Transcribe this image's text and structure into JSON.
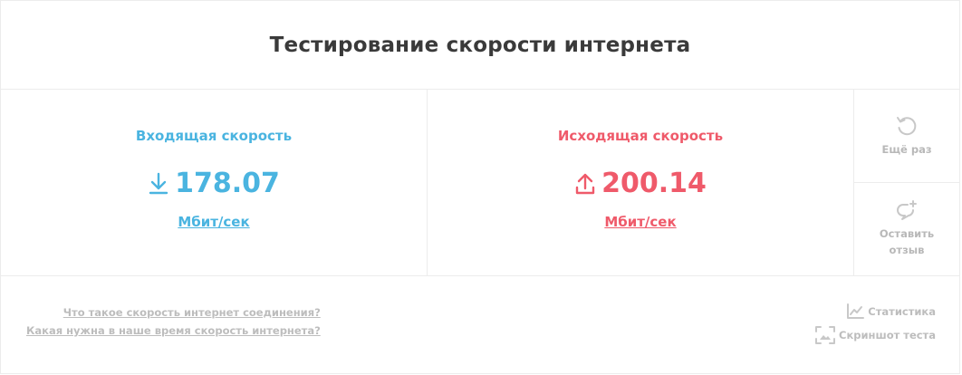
{
  "header": {
    "title": "Тестирование скорости интернета"
  },
  "download": {
    "label": "Входящая скорость",
    "value": "178.07",
    "unit": "Мбит/сек",
    "icon": "download-arrow-icon",
    "color": "#4ab4e0"
  },
  "upload": {
    "label": "Исходящая скорость",
    "value": "200.14",
    "unit": "Мбит/сек",
    "icon": "upload-arrow-icon",
    "color": "#ef5a6a"
  },
  "side": {
    "retry_label": "Ещё раз",
    "retry_icon": "refresh-icon",
    "feedback_label_line1": "Оставить",
    "feedback_label_line2": "отзыв",
    "feedback_icon": "comment-add-icon"
  },
  "footer": {
    "links": [
      "Что такое скорость интернет соединения?",
      "Какая нужна в наше время скорость интернета?"
    ],
    "statistics_label": "Статистика",
    "statistics_icon": "line-chart-icon",
    "screenshot_label": "Скриншот теста",
    "screenshot_icon": "screenshot-icon"
  }
}
